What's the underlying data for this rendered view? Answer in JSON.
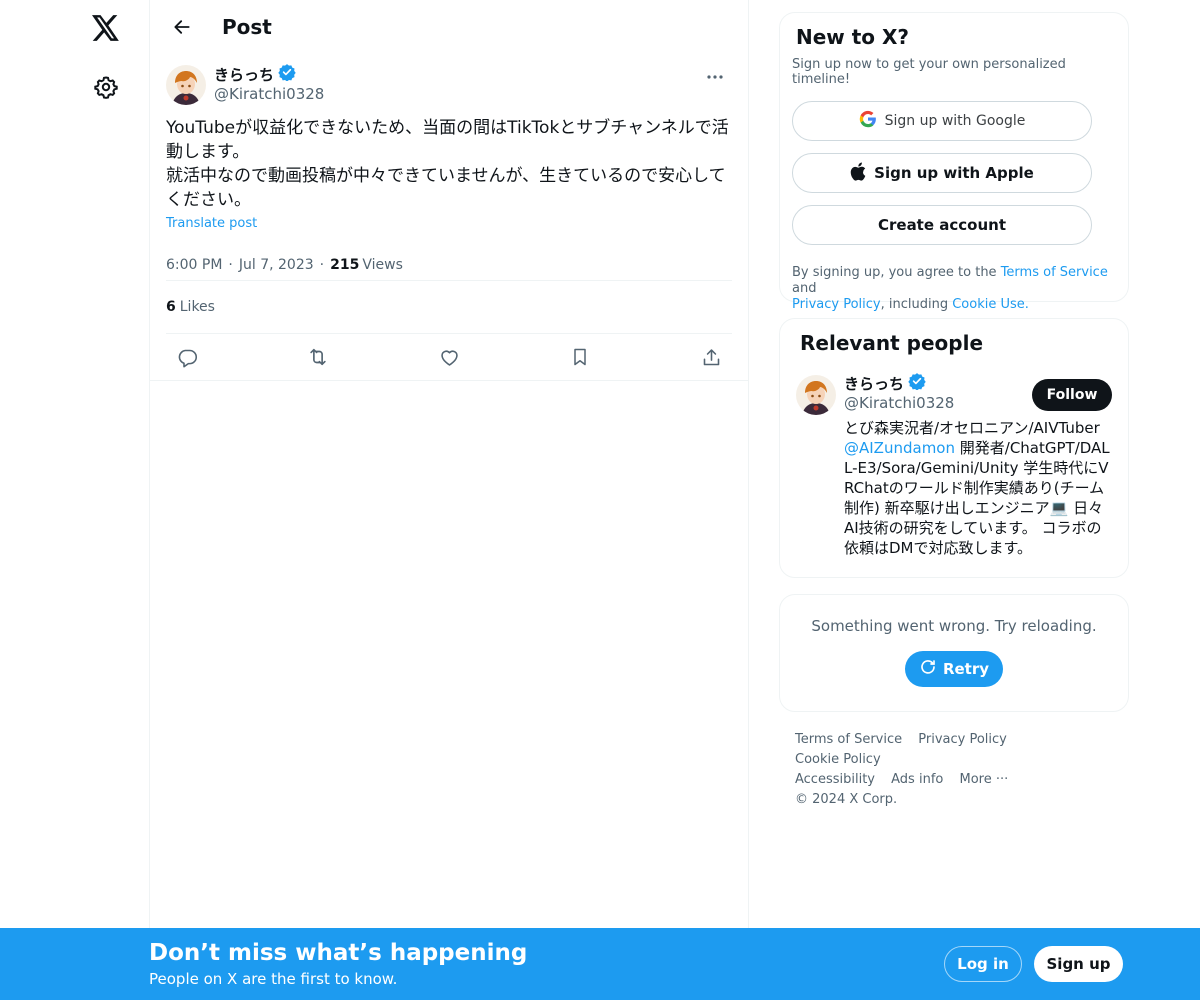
{
  "header": {
    "title": "Post"
  },
  "post": {
    "author_name": "きらっち",
    "author_handle": "@Kiratchi0328",
    "text": "YouTubeが収益化できないため、当面の間はTikTokとサブチャンネルで活動します。\n就活中なので動画投稿が中々できていませんが、生きているので安心してください。",
    "translate_label": "Translate post",
    "time": "6:00 PM",
    "date": "Jul 7, 2023",
    "views_count": "215",
    "views_label": "Views",
    "likes_count": "6",
    "likes_label": "Likes",
    "icons": [
      "reply-icon",
      "repost-icon",
      "like-icon",
      "bookmark-icon",
      "share-icon"
    ]
  },
  "signup_card": {
    "title": "New to X?",
    "subtitle": "Sign up now to get your own personalized timeline!",
    "google_label": "Sign up with Google",
    "apple_label": "Sign up with Apple",
    "create_label": "Create account",
    "legal_prefix": "By signing up, you agree to the",
    "terms_link": "Terms of Service",
    "and": "and",
    "privacy_link": "Privacy Policy",
    "including": ", including",
    "cookie_link": "Cookie Use."
  },
  "relevant_people": {
    "title": "Relevant people",
    "name": "きらっち",
    "handle": "@Kiratchi0328",
    "follow_label": "Follow",
    "bio_part1": "とび森実況者/オセロニアン/AIVTuber",
    "bio_link": "@AIZundamon",
    "bio_part2": "開発者/ChatGPT/DALL-E3/Sora/Gemini/Unity 学生時代にVRChatのワールド制作実績あり(チーム制作) 新卒駆け出しエンジニア💻 日々AI技術の研究をしています。 コラボの依頼はDMで対応致します。"
  },
  "error_card": {
    "message": "Something went wrong. Try reloading.",
    "retry_label": "Retry"
  },
  "footer": {
    "links": [
      "Terms of Service",
      "Privacy Policy",
      "Cookie Policy",
      "Accessibility",
      "Ads info",
      "More ···",
      "© 2024 X Corp."
    ]
  },
  "bottom_bar": {
    "title": "Don’t miss what’s happening",
    "subtitle": "People on X are the first to know.",
    "login_label": "Log in",
    "signup_label": "Sign up"
  },
  "colors": {
    "accent": "#1d9bf0",
    "text": "#0f1419",
    "secondary": "#536471",
    "border": "#eff3f4"
  }
}
